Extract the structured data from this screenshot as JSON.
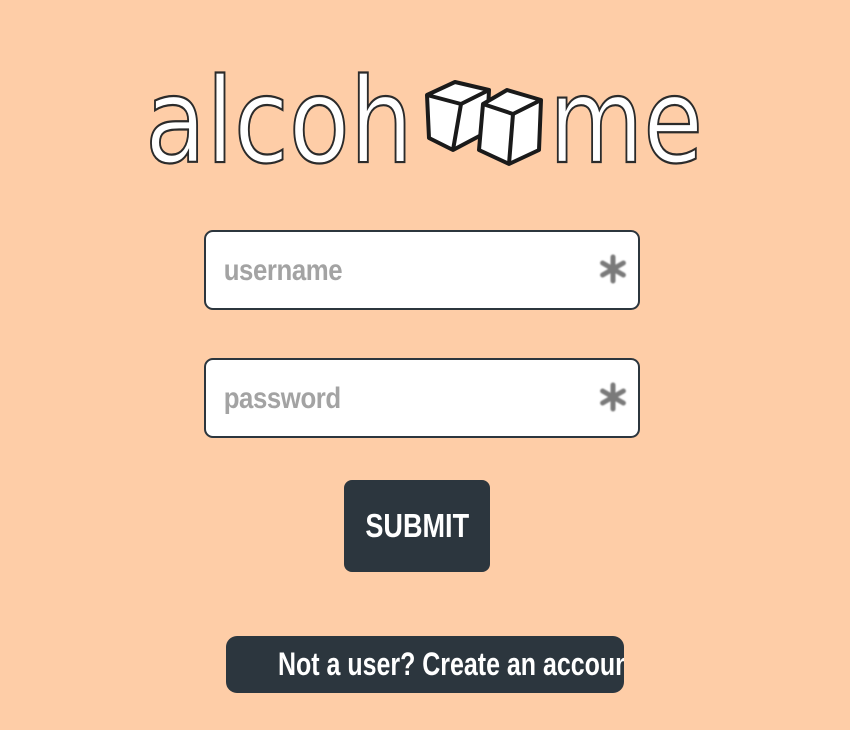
{
  "logo": {
    "text_left": "alcoh",
    "text_right": "me",
    "icon": "ice-cubes-icon"
  },
  "form": {
    "username": {
      "placeholder": "username",
      "value": "",
      "required_icon": "asterisk-icon"
    },
    "password": {
      "placeholder": "password",
      "value": "",
      "required_icon": "asterisk-icon"
    },
    "submit_label": "SUBMIT"
  },
  "signup_link": {
    "label": "Not a user? Create an account!"
  },
  "colors": {
    "background": "#fecda7",
    "dark": "#2c363e",
    "placeholder": "#a3a3a3",
    "field_bg": "#ffffff"
  }
}
